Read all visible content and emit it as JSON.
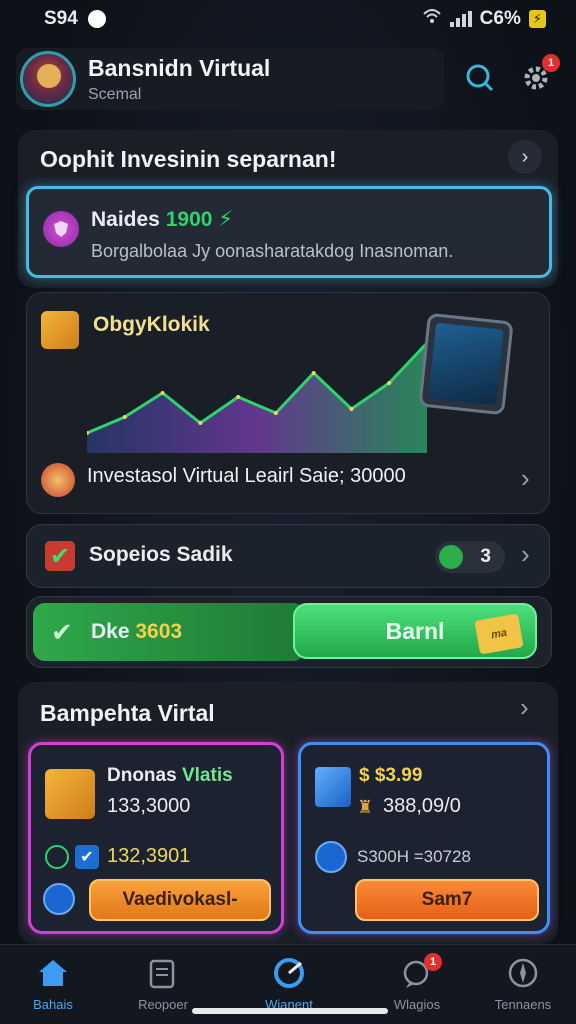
{
  "status": {
    "time": "S94",
    "battery": "C6%"
  },
  "header": {
    "name": "Bansnidn Virtual",
    "subtitle": "Scemal",
    "notification_count": "1"
  },
  "intro": {
    "title": "Oophit Invesinin separnan!"
  },
  "invest_banner": {
    "title": "Naides",
    "amount": "1900",
    "desc": "Borgalbolaa Jy oonasharatakdog Inasnoman."
  },
  "chart": {
    "label": "ObgyKlokik",
    "investment_line": "Investasol Virtual Leairl Saie; 30000",
    "accent_color": "#2fd36b"
  },
  "chart_data": {
    "type": "area",
    "series": [
      {
        "values": [
          10,
          18,
          30,
          15,
          28,
          20,
          40,
          22,
          35,
          55
        ]
      }
    ]
  },
  "tasks_row": {
    "label": "Sopeios Sadik",
    "count": "3"
  },
  "deposit_row": {
    "label": "Dke",
    "amount": "3603",
    "earn_button": "Barnl",
    "tag": "ma"
  },
  "bottom": {
    "title": "Bampehta Virtal",
    "card_a": {
      "title": "Dnonas",
      "highlight": "Vlatis",
      "value": "133,3000",
      "secondary": "132,3901",
      "button": "Vaedivokasl-"
    },
    "card_b": {
      "amount": "$ $3.99",
      "value": "388,09/0",
      "secondary": "S300H =30728",
      "button": "Sam7"
    }
  },
  "nav": [
    {
      "label": "Bahais",
      "icon": "home-icon"
    },
    {
      "label": "Reopoer",
      "icon": "document-icon"
    },
    {
      "label": "Wianent",
      "icon": "globe-icon"
    },
    {
      "label": "Wlagios",
      "icon": "chat-icon"
    },
    {
      "label": "Tennaens",
      "icon": "compass-icon"
    }
  ]
}
